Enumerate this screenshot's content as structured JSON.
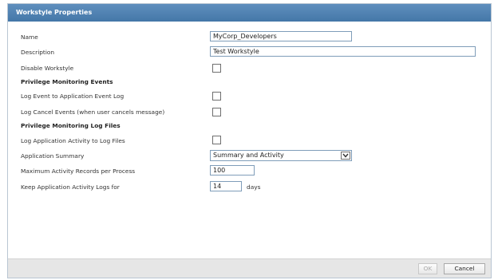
{
  "dialog": {
    "title": "Workstyle Properties"
  },
  "fields": {
    "name": {
      "label": "Name",
      "value": "MyCorp_Developers"
    },
    "description": {
      "label": "Description",
      "value": "Test Workstyle"
    },
    "disable_workstyle": {
      "label": "Disable Workstyle",
      "checked": false
    },
    "privilege_monitoring_events_heading": "Privilege Monitoring Events",
    "log_event_app_event_log": {
      "label": "Log Event to Application Event Log",
      "checked": false
    },
    "log_cancel_events": {
      "label": "Log Cancel Events (when user cancels message)",
      "checked": false
    },
    "privilege_monitoring_log_files_heading": "Privilege Monitoring Log Files",
    "log_app_activity_to_log_files": {
      "label": "Log Application Activity to Log Files",
      "checked": false
    },
    "application_summary": {
      "label": "Application Summary",
      "value": "Summary and Activity"
    },
    "max_activity_records": {
      "label": "Maximum Activity Records per Process",
      "value": "100"
    },
    "keep_activity_logs": {
      "label": "Keep Application Activity Logs for",
      "value": "14",
      "unit": "days"
    }
  },
  "footer": {
    "ok_label": "OK",
    "cancel_label": "Cancel"
  },
  "colors": {
    "title_bar": "#4f82b2",
    "footer_bg": "#e6e6e6",
    "field_border": "#7f9db9"
  }
}
